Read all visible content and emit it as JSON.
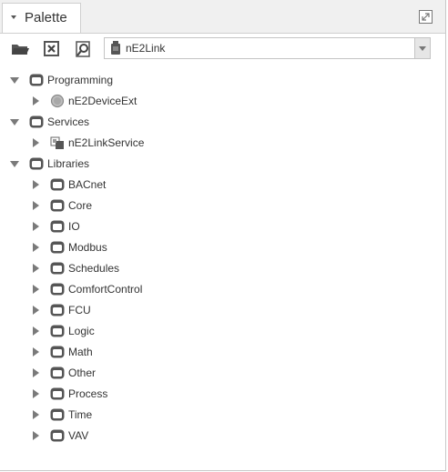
{
  "tab": {
    "title": "Palette"
  },
  "toolbar": {
    "open_label": "open-palette",
    "close_label": "close-palette",
    "find_label": "find-palette",
    "selected_palette": "nE2Link"
  },
  "tree": [
    {
      "label": "Programming",
      "kind": "folder",
      "expanded": true,
      "level": 0
    },
    {
      "label": "nE2DeviceExt",
      "kind": "device-ext",
      "expanded": false,
      "level": 1
    },
    {
      "label": "Services",
      "kind": "folder",
      "expanded": true,
      "level": 0
    },
    {
      "label": "nE2LinkService",
      "kind": "service",
      "expanded": false,
      "level": 1
    },
    {
      "label": "Libraries",
      "kind": "folder",
      "expanded": true,
      "level": 0
    },
    {
      "label": "BACnet",
      "kind": "folder",
      "expanded": false,
      "level": 1
    },
    {
      "label": "Core",
      "kind": "folder",
      "expanded": false,
      "level": 1
    },
    {
      "label": "IO",
      "kind": "folder",
      "expanded": false,
      "level": 1
    },
    {
      "label": "Modbus",
      "kind": "folder",
      "expanded": false,
      "level": 1
    },
    {
      "label": "Schedules",
      "kind": "folder",
      "expanded": false,
      "level": 1
    },
    {
      "label": "ComfortControl",
      "kind": "folder",
      "expanded": false,
      "level": 1
    },
    {
      "label": "FCU",
      "kind": "folder",
      "expanded": false,
      "level": 1
    },
    {
      "label": "Logic",
      "kind": "folder",
      "expanded": false,
      "level": 1
    },
    {
      "label": "Math",
      "kind": "folder",
      "expanded": false,
      "level": 1
    },
    {
      "label": "Other",
      "kind": "folder",
      "expanded": false,
      "level": 1
    },
    {
      "label": "Process",
      "kind": "folder",
      "expanded": false,
      "level": 1
    },
    {
      "label": "Time",
      "kind": "folder",
      "expanded": false,
      "level": 1
    },
    {
      "label": "VAV",
      "kind": "folder",
      "expanded": false,
      "level": 1
    }
  ],
  "colors": {
    "icon": "#555555",
    "toggle": "#7a7a7a",
    "text": "#333333"
  }
}
